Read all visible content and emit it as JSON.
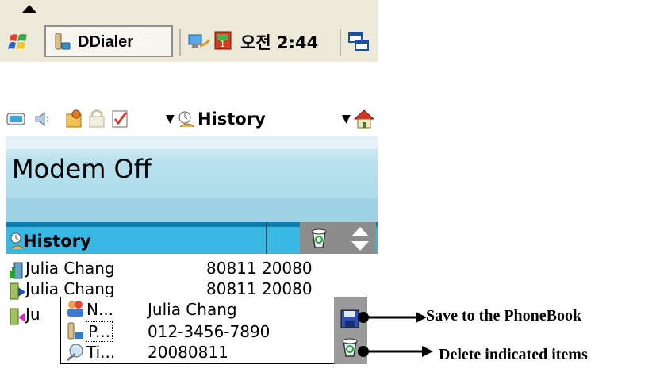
{
  "taskbar": {
    "task_label": "DDialer",
    "clock": "오전 2:44"
  },
  "toolbar": {
    "menu_label": "History"
  },
  "modem": {
    "status": "Modem Off"
  },
  "history_header": {
    "label": "History"
  },
  "history_rows": [
    {
      "name": "Julia Chang",
      "number": "80811 20080"
    },
    {
      "name": "Julia Chang",
      "number": "80811 20080"
    },
    {
      "name": "Ju",
      "number": ""
    }
  ],
  "popup": {
    "rows": [
      {
        "key": "N...",
        "value": "Julia Chang"
      },
      {
        "key": "P...",
        "value": "012-3456-7890"
      },
      {
        "key": "Ti...",
        "value": "20080811"
      }
    ]
  },
  "annotations": {
    "save": "Save to the PhoneBook",
    "delete": "Delete indicated items"
  },
  "colors": {
    "taskbar_bg": "#ece9d8",
    "header_blue": "#39b8e4",
    "panel_cyan": "#a6d8e8"
  }
}
